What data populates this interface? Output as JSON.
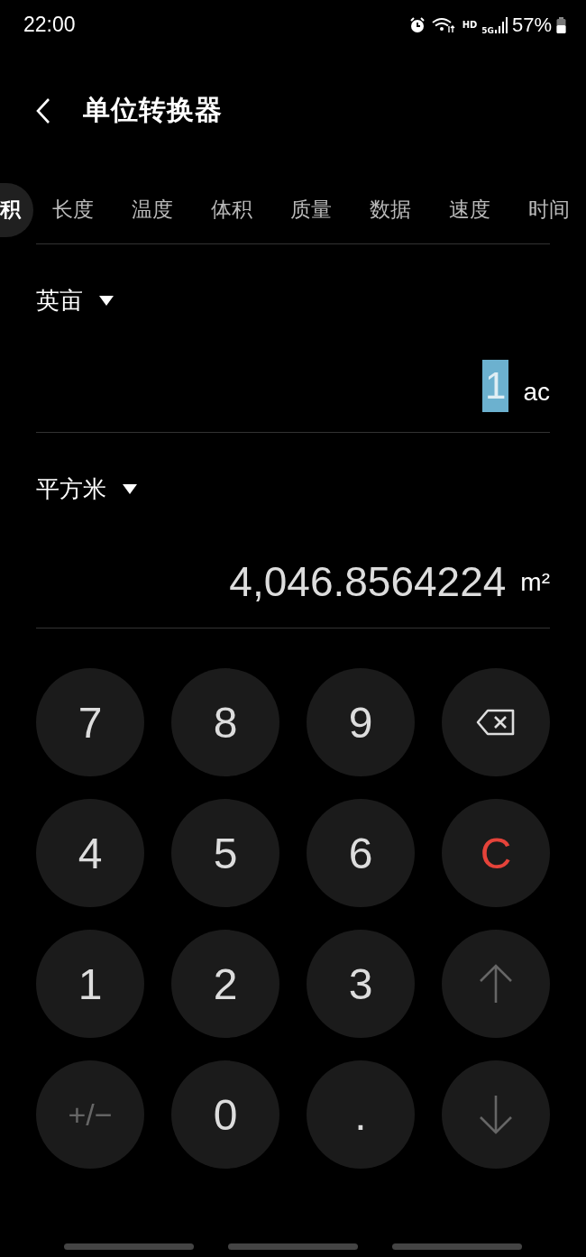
{
  "status_bar": {
    "time": "22:00",
    "network_hd": "HD",
    "network_type": "5G",
    "battery": "57%"
  },
  "header": {
    "title": "单位转换器"
  },
  "tabs": [
    {
      "label": "积",
      "selected": true
    },
    {
      "label": "长度",
      "selected": false
    },
    {
      "label": "温度",
      "selected": false
    },
    {
      "label": "体积",
      "selected": false
    },
    {
      "label": "质量",
      "selected": false
    },
    {
      "label": "数据",
      "selected": false
    },
    {
      "label": "速度",
      "selected": false
    },
    {
      "label": "时间",
      "selected": false
    }
  ],
  "source": {
    "unit": "英亩",
    "value": "1",
    "value_selected": true,
    "symbol": "ac"
  },
  "target": {
    "unit": "平方米",
    "value": "4,046.8564224",
    "symbol": "m²"
  },
  "keys": [
    {
      "kind": "text",
      "label": "7",
      "disabled": false
    },
    {
      "kind": "text",
      "label": "8",
      "disabled": false
    },
    {
      "kind": "text",
      "label": "9",
      "disabled": false
    },
    {
      "kind": "backspace",
      "disabled": false
    },
    {
      "kind": "text",
      "label": "4",
      "disabled": false
    },
    {
      "kind": "text",
      "label": "5",
      "disabled": false
    },
    {
      "kind": "text",
      "label": "6",
      "disabled": false
    },
    {
      "kind": "clear",
      "label": "C",
      "disabled": false
    },
    {
      "kind": "text",
      "label": "1",
      "disabled": false
    },
    {
      "kind": "text",
      "label": "2",
      "disabled": false
    },
    {
      "kind": "text",
      "label": "3",
      "disabled": false
    },
    {
      "kind": "up",
      "disabled": true
    },
    {
      "kind": "text",
      "label": "+/−",
      "disabled": true
    },
    {
      "kind": "text",
      "label": "0",
      "disabled": false
    },
    {
      "kind": "text",
      "label": ".",
      "disabled": false
    },
    {
      "kind": "down",
      "disabled": true
    }
  ]
}
